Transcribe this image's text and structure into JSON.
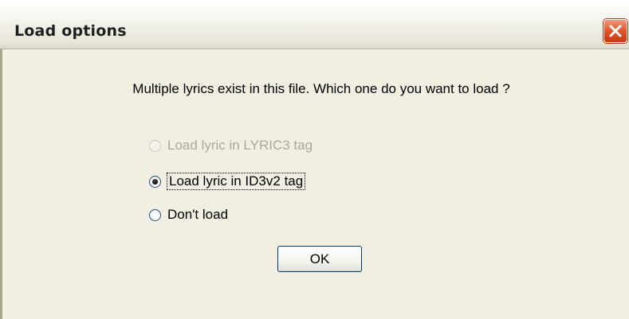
{
  "window": {
    "title": "Load options",
    "close_icon": "close-icon"
  },
  "dialog": {
    "message": "Multiple lyrics exist in this file. Which one do you want to load ?",
    "options": [
      {
        "label": "Load lyric in LYRIC3 tag",
        "selected": false,
        "enabled": false
      },
      {
        "label": "Load lyric in ID3v2 tag",
        "selected": true,
        "enabled": true,
        "focused": true
      },
      {
        "label": "Don't load",
        "selected": false,
        "enabled": true
      }
    ],
    "ok_label": "OK"
  },
  "colors": {
    "title_close_red": "#e1542a",
    "face": "#f1efe2",
    "disabled_text": "#aca899",
    "button_border": "#003c74"
  }
}
